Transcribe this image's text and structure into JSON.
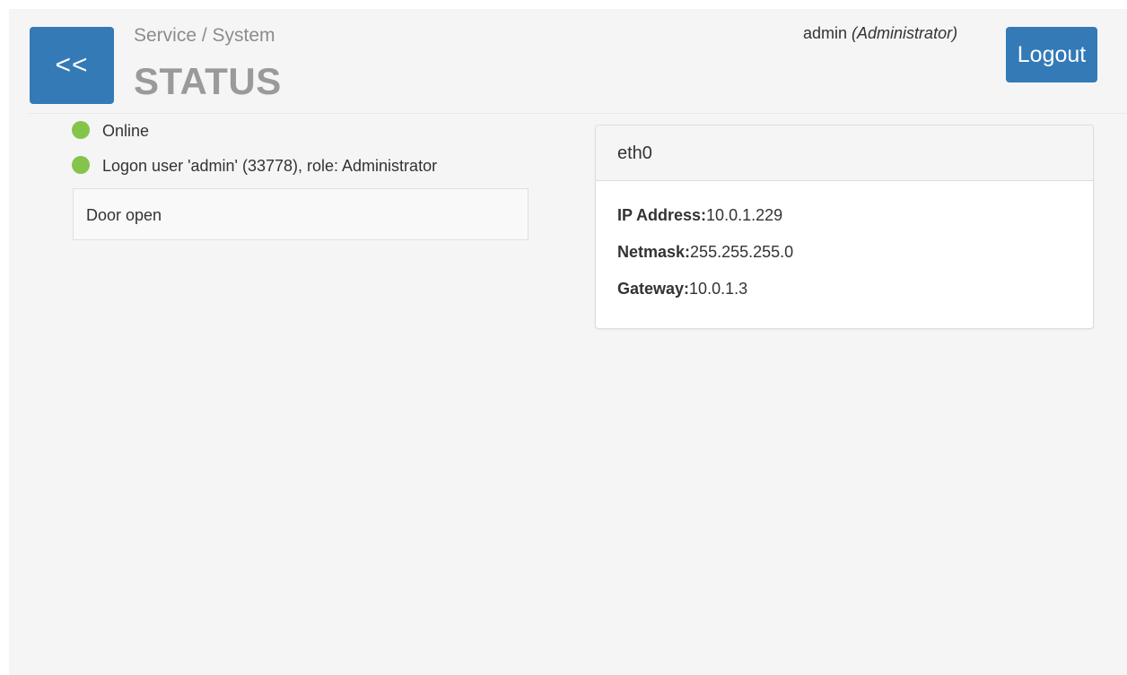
{
  "header": {
    "back_label": "<<",
    "breadcrumb": "Service / System",
    "title": "STATUS",
    "user_name": "admin",
    "user_role": "(Administrator)",
    "logout_label": "Logout"
  },
  "status": {
    "items": [
      {
        "text": "Online",
        "indicator": "green-dot",
        "color": "#84c44a"
      },
      {
        "text": "Logon user 'admin' (33778), role: Administrator",
        "indicator": "green-dot",
        "color": "#84c44a"
      }
    ],
    "door": "Door open"
  },
  "network": {
    "interface": "eth0",
    "fields": [
      {
        "label": "IP Address:",
        "value": "10.0.1.229"
      },
      {
        "label": "Netmask:",
        "value": "255.255.255.0"
      },
      {
        "label": "Gateway:",
        "value": "10.0.1.3"
      }
    ]
  },
  "colors": {
    "primary": "#337ab7",
    "status_ok": "#84c44a"
  }
}
